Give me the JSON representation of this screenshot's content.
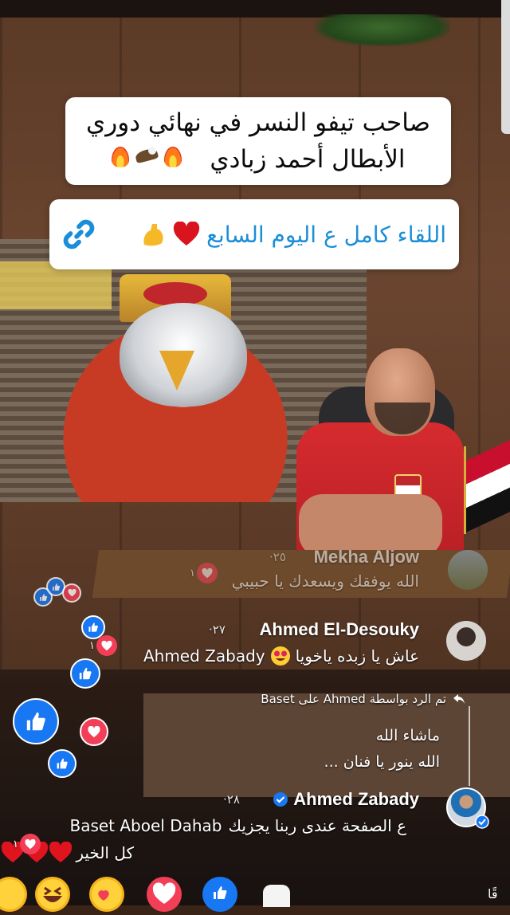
{
  "video": {
    "title_line1": "صاحب تيفو النسر في نهائي دوري",
    "title_line2": "الأبطال أحمد زبادي",
    "link_text": "اللقاء كامل ع اليوم السابع"
  },
  "comments": [
    {
      "author": "Mekha Aljow",
      "time": "·٢٥",
      "text": "الله يوفقك ويسعدك يا حبيبي",
      "reactions": "١"
    },
    {
      "author": "Ahmed El-Desouky",
      "time": "·٢٧",
      "text_ar": "عاش يا زبده ياخويا",
      "text_tag": "Ahmed Zabady",
      "reactions": "١"
    },
    {
      "reply_header": "تم الرد بواسطة Ahmed على Baset",
      "reply_lines": [
        "ماشاء الله",
        "الله ينور يا فنان ..."
      ]
    },
    {
      "author": "Ahmed Zabady",
      "verified": true,
      "time": "·٢٨",
      "text_line1_tag": "Baset Aboel Dahab",
      "text_line1_ar": "ع الصفحة عندى ربنا يجزيك",
      "text_line2_ar": "كل الخير",
      "reactions": "١"
    }
  ],
  "bottom": {
    "corner_text": "قًا"
  },
  "colors": {
    "like_blue": "#1877f2",
    "love_red": "#f33e58",
    "link_blue": "#1a8ed8"
  }
}
